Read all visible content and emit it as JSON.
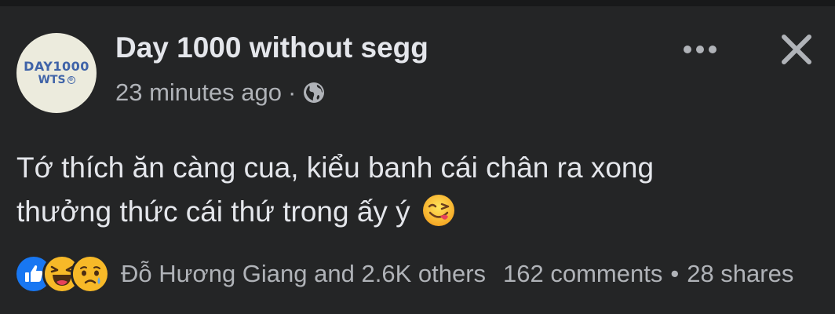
{
  "post": {
    "avatar": {
      "line1": "DAY1000",
      "line2": "WTS",
      "icon": "page-logo"
    },
    "page_name": "Day 1000 without segg",
    "time_ago": "23 minutes ago",
    "meta_separator": "·",
    "privacy_icon": "globe-icon",
    "more_icon": "ellipsis-icon",
    "close_icon": "close-icon",
    "text_lines": [
      "Tớ thích ăn càng cua, kiểu banh cái chân ra xong",
      "thưởng thức cái thứ trong ấy ý"
    ],
    "text_emoji": "face-savoring-food-icon"
  },
  "footer": {
    "reaction_icons": [
      "like-icon",
      "haha-icon",
      "sad-icon"
    ],
    "reacted_by": "Đỗ Hương Giang and 2.6K others",
    "comments": "162 comments",
    "separator": "•",
    "shares": "28 shares"
  },
  "colors": {
    "background": "#242526",
    "text_primary": "#e4e6eb",
    "text_secondary": "#b0b3b8",
    "like_blue": "#1877f2",
    "emoji_yellow": "#f7b928"
  }
}
